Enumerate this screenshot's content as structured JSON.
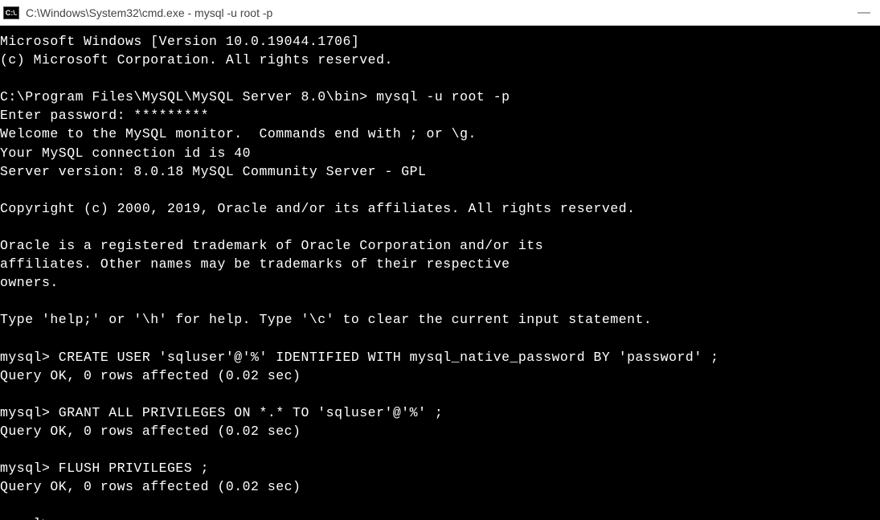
{
  "window": {
    "icon_text": "C:\\.",
    "title": "C:\\Windows\\System32\\cmd.exe - mysql  -u root -p",
    "minimize": "—"
  },
  "terminal": {
    "lines": [
      "Microsoft Windows [Version 10.0.19044.1706]",
      "(c) Microsoft Corporation. All rights reserved.",
      "",
      "C:\\Program Files\\MySQL\\MySQL Server 8.0\\bin> mysql -u root -p",
      "Enter password: *********",
      "Welcome to the MySQL monitor.  Commands end with ; or \\g.",
      "Your MySQL connection id is 40",
      "Server version: 8.0.18 MySQL Community Server - GPL",
      "",
      "Copyright (c) 2000, 2019, Oracle and/or its affiliates. All rights reserved.",
      "",
      "Oracle is a registered trademark of Oracle Corporation and/or its",
      "affiliates. Other names may be trademarks of their respective",
      "owners.",
      "",
      "Type 'help;' or '\\h' for help. Type '\\c' to clear the current input statement.",
      "",
      "mysql> CREATE USER 'sqluser'@'%' IDENTIFIED WITH mysql_native_password BY 'password' ;",
      "Query OK, 0 rows affected (0.02 sec)",
      "",
      "mysql> GRANT ALL PRIVILEGES ON *.* TO 'sqluser'@'%' ;",
      "Query OK, 0 rows affected (0.02 sec)",
      "",
      "mysql> FLUSH PRIVILEGES ;",
      "Query OK, 0 rows affected (0.02 sec)",
      "",
      "mysql>"
    ]
  }
}
